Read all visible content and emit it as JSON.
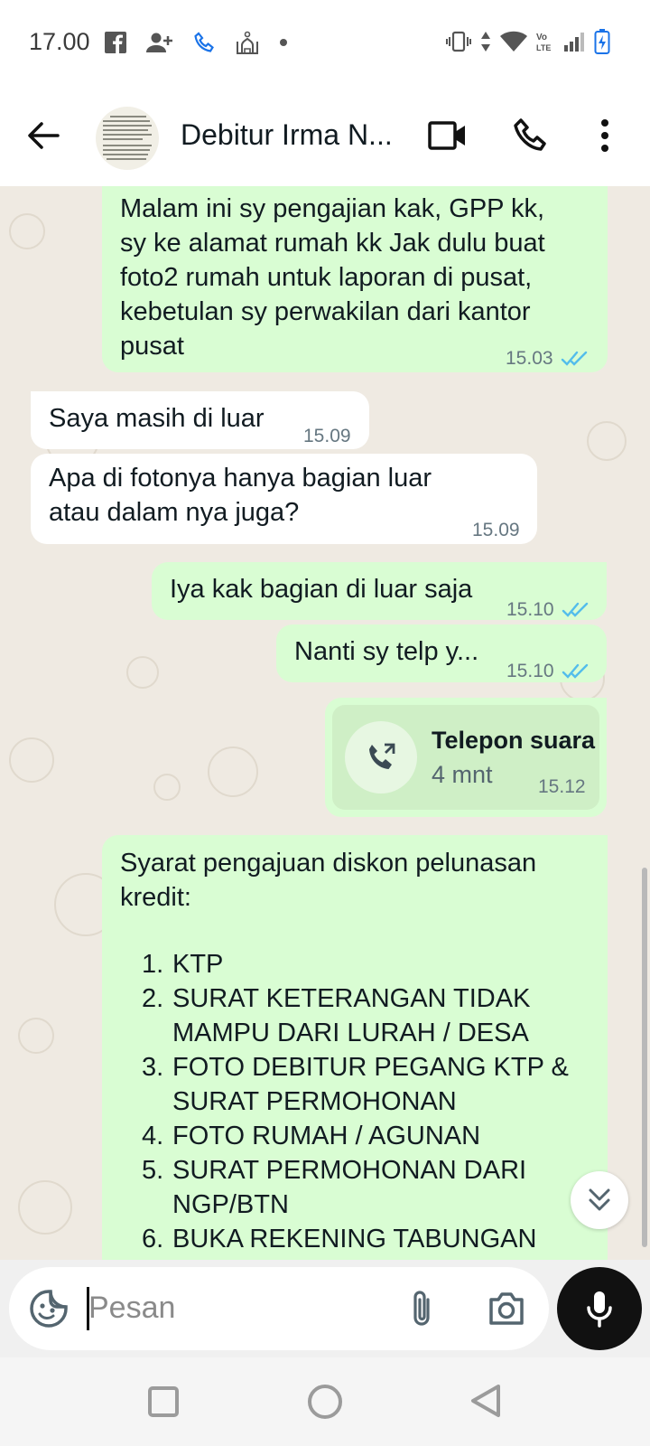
{
  "status_bar": {
    "time": "17.00"
  },
  "header": {
    "contact_name": "Debitur Irma N..."
  },
  "messages": [
    {
      "dir": "out",
      "text": "Malam ini sy pengajian kak, GPP kk,\nsy ke alamat rumah kk Jak dulu buat\nfoto2 rumah untuk laporan di pusat,\nkebetulan sy perwakilan dari kantor\npusat",
      "time": "15.03"
    },
    {
      "dir": "in",
      "text": "Saya masih di luar",
      "time": "15.09"
    },
    {
      "dir": "in",
      "text": "Apa di fotonya hanya bagian luar\natau dalam nya juga?",
      "time": "15.09"
    },
    {
      "dir": "out",
      "text": "Iya kak bagian di luar saja",
      "time": "15.10"
    },
    {
      "dir": "out",
      "text": "Nanti sy telp y...",
      "time": "15.10"
    },
    {
      "dir": "out",
      "type": "call",
      "title": "Telepon suara",
      "duration": "4 mnt",
      "time": "15.12"
    },
    {
      "dir": "out",
      "intro": "Syarat pengajuan diskon pelunasan\nkredit:",
      "list": [
        {
          "num": "1.",
          "text": "KTP"
        },
        {
          "num": "2.",
          "text": "SURAT KETERANGAN TIDAK\nMAMPU DARI LURAH / DESA"
        },
        {
          "num": "3.",
          "text": "FOTO DEBITUR PEGANG KTP &\nSURAT PERMOHONAN"
        },
        {
          "num": "4.",
          "text": "FOTO RUMAH / AGUNAN"
        },
        {
          "num": "5.",
          "text": "SURAT PERMOHONAN DARI\nNGP/BTN"
        },
        {
          "num": "6.",
          "text": "BUKA REKENING TABUNGAN"
        }
      ]
    }
  ],
  "input": {
    "placeholder": "Pesan"
  },
  "icons": {
    "back": "arrow-left-icon",
    "video": "video-call-icon",
    "call": "phone-icon",
    "more": "more-vert-icon",
    "sticker": "sticker-icon",
    "attach": "paperclip-icon",
    "camera": "camera-icon",
    "mic": "mic-icon",
    "read": "double-check-icon",
    "scroll": "chevron-double-down-icon"
  },
  "colors": {
    "outgoing": "#d9fdd3",
    "incoming": "#ffffff",
    "read_tick": "#53bdeb",
    "chat_bg": "#efeae2"
  }
}
